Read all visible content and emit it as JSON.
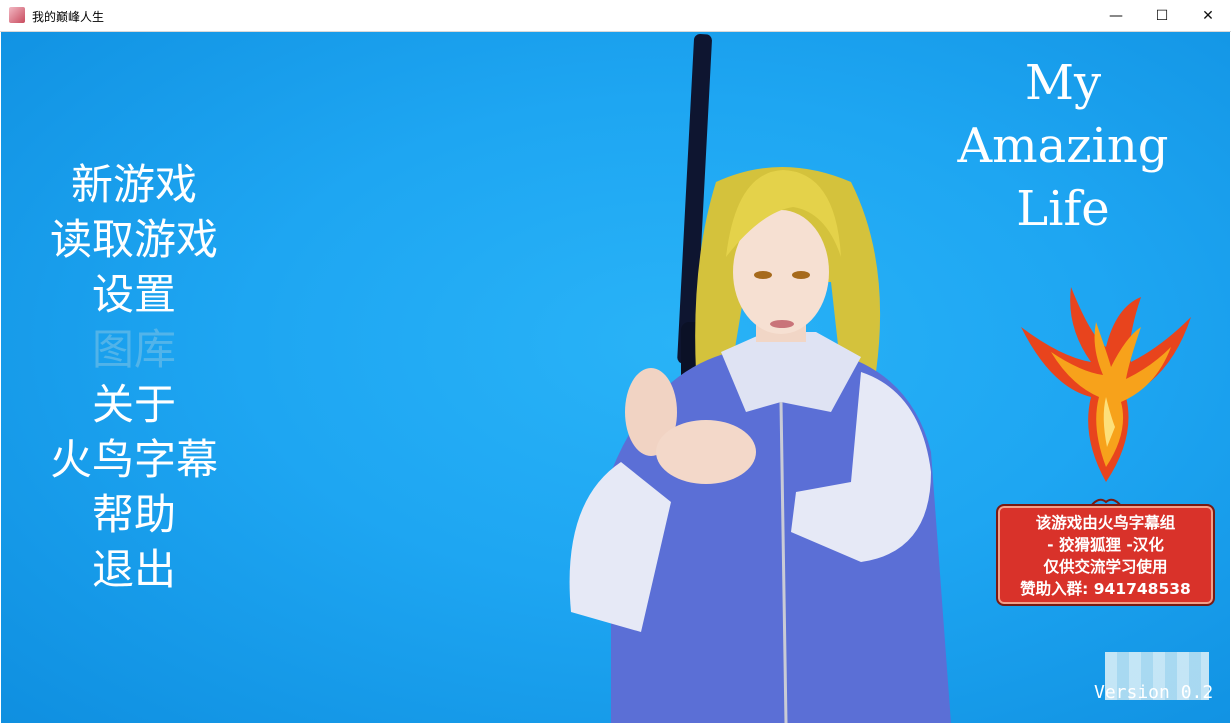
{
  "window": {
    "title": "我的巅峰人生",
    "minimize_glyph": "—",
    "maximize_glyph": "☐",
    "close_glyph": "✕"
  },
  "menu": {
    "items": [
      {
        "label": "新游戏",
        "enabled": true
      },
      {
        "label": "读取游戏",
        "enabled": true
      },
      {
        "label": "设置",
        "enabled": true
      },
      {
        "label": "图库",
        "enabled": false
      },
      {
        "label": "关于",
        "enabled": true
      },
      {
        "label": "火鸟字幕",
        "enabled": true
      },
      {
        "label": "帮助",
        "enabled": true
      },
      {
        "label": "退出",
        "enabled": true
      }
    ]
  },
  "logo": {
    "line1": "My",
    "line2": "Amazing",
    "line3": "Life"
  },
  "badge": {
    "line1": "该游戏由火鸟字幕组",
    "line2": "- 狡猾狐狸 -汉化",
    "line3": "仅供交流学习使用",
    "line4": "赞助入群: 941748538"
  },
  "version": {
    "text": "Version 0.2"
  },
  "colors": {
    "background": "#1ea6f2",
    "menu_text": "#ffffff",
    "menu_disabled": "#7fc4e6",
    "badge_bg": "#d9322a"
  }
}
